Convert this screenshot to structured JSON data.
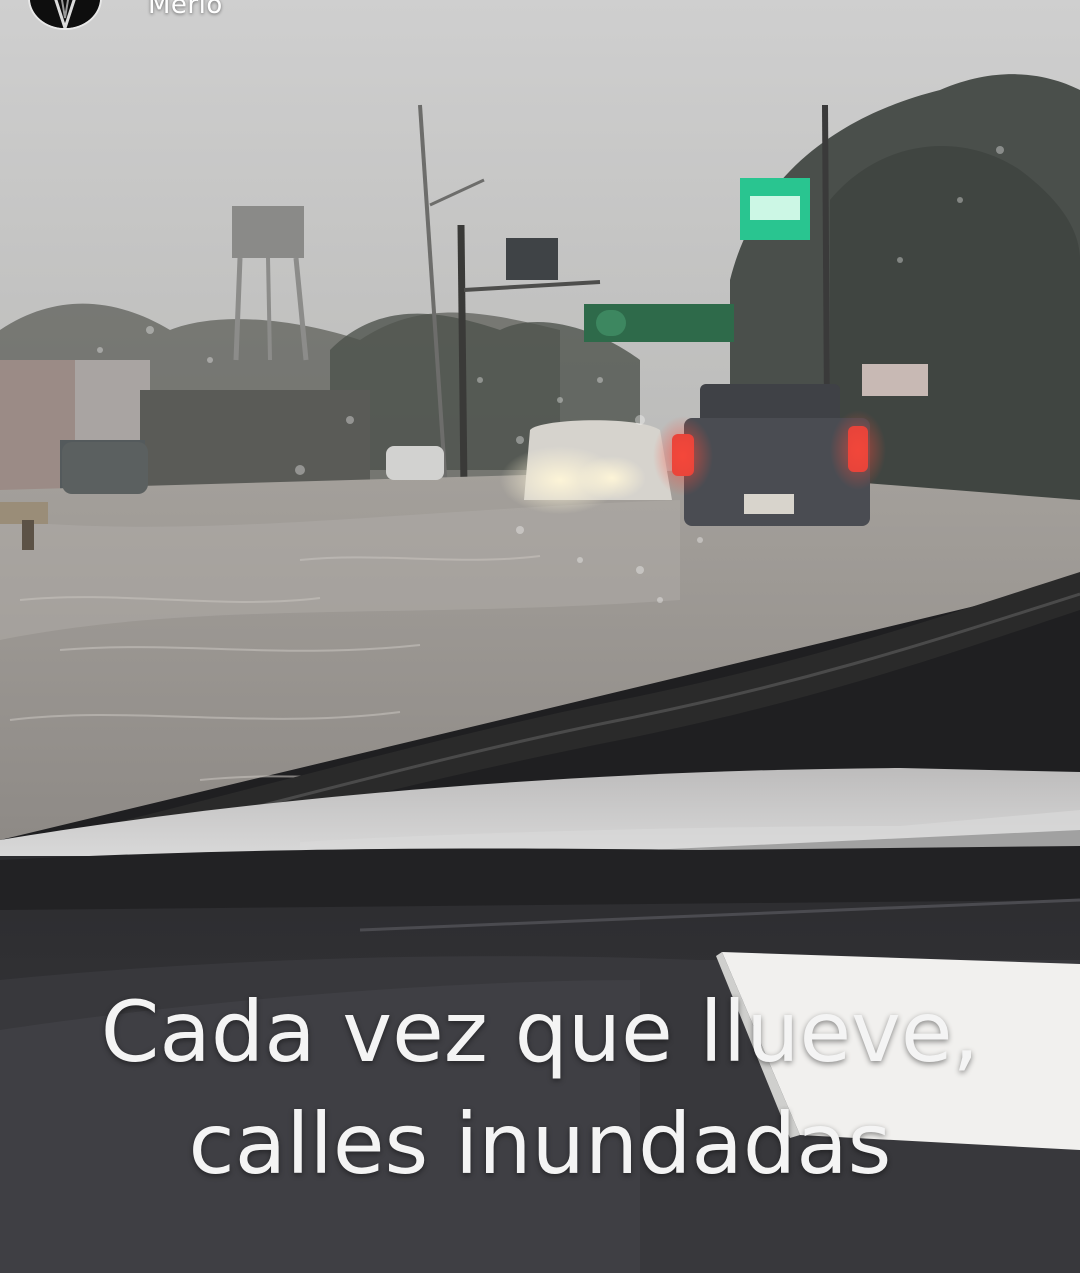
{
  "story": {
    "username": "Merlo",
    "caption_line1": "Cada vez que llueve,",
    "caption_line2": "calles inundadas"
  },
  "icons": {
    "avatar": "profile-avatar-icon"
  }
}
